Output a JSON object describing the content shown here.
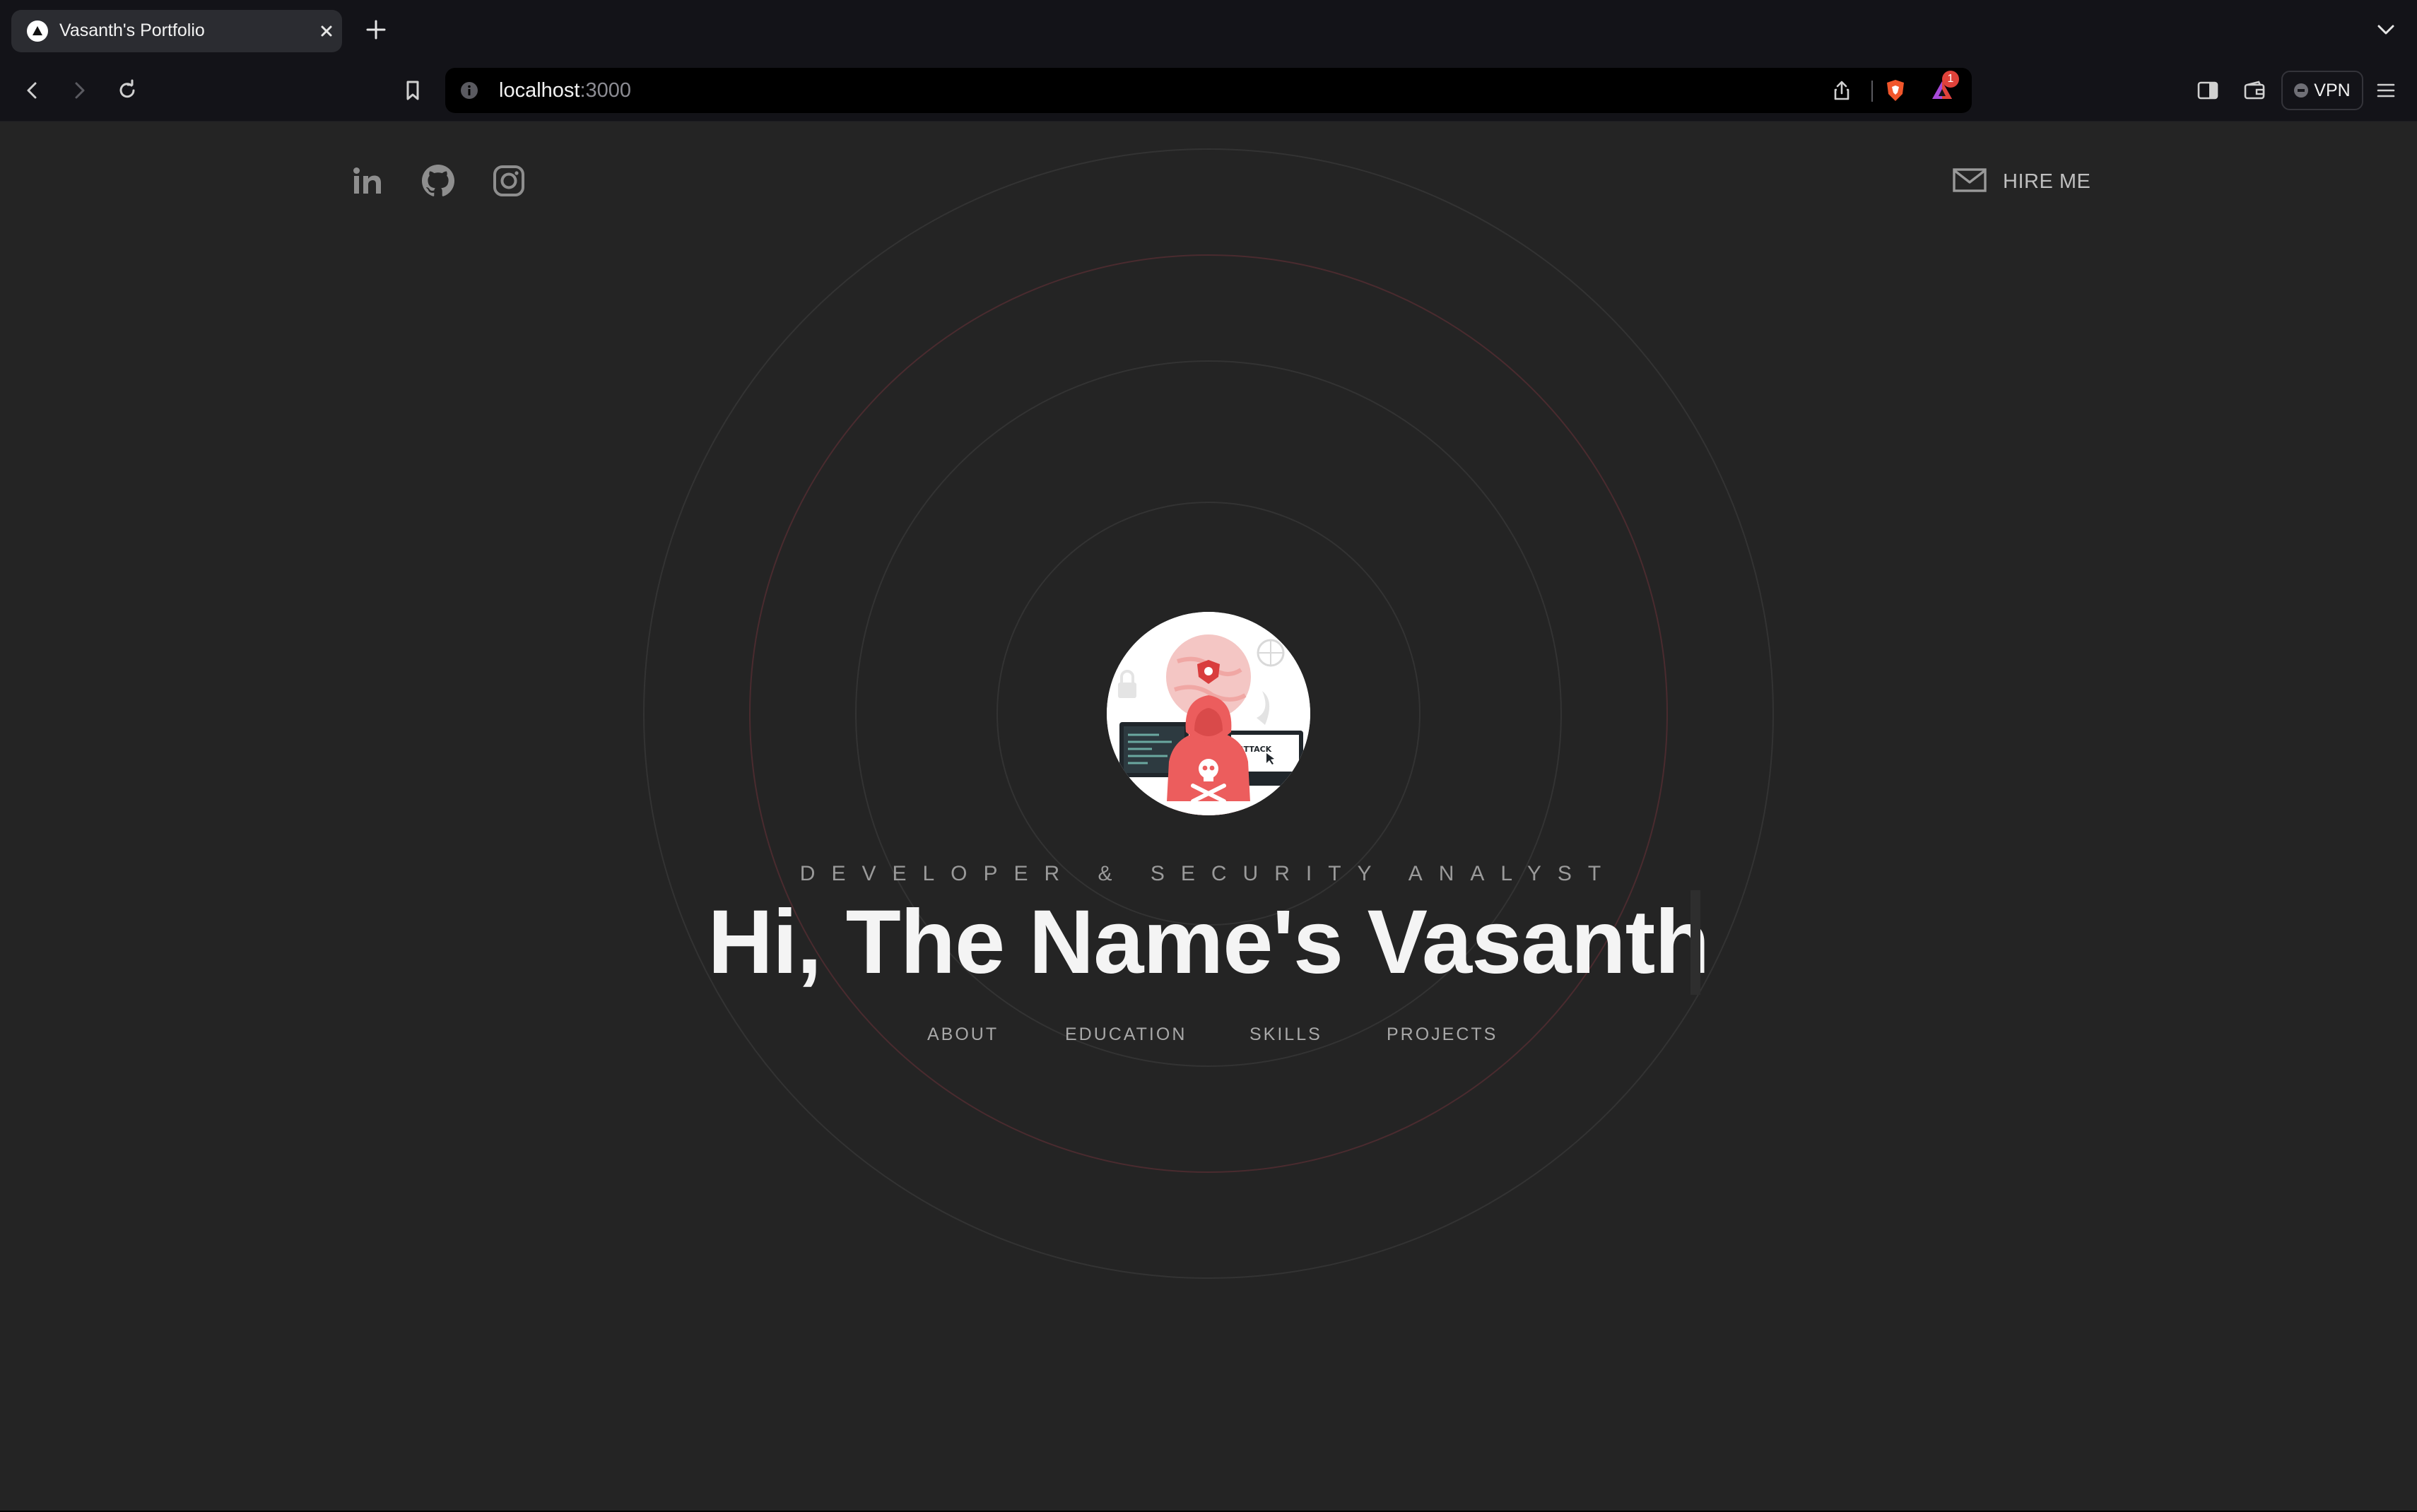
{
  "browser": {
    "tab_title": "Vasanth's Portfolio",
    "url_host": "localhost",
    "url_port": ":3000",
    "rewards_count": "1",
    "vpn_label": "VPN"
  },
  "header": {
    "social_links": [
      "linkedin-icon",
      "github-icon",
      "instagram-icon"
    ],
    "hire_label": "HIRE ME"
  },
  "hero": {
    "subtitle": "DEVELOPER & SECURITY ANALYST",
    "headline": "Hi, The Name's Vasanth",
    "avatar_attack_text": "ATTACK",
    "nav": [
      "ABOUT",
      "EDUCATION",
      "SKILLS",
      "PROJECTS"
    ]
  },
  "colors": {
    "page_bg": "#242424",
    "accent": "#ec5d5d",
    "ring_gray": "#353535",
    "ring_red": "#4a2a2e"
  }
}
